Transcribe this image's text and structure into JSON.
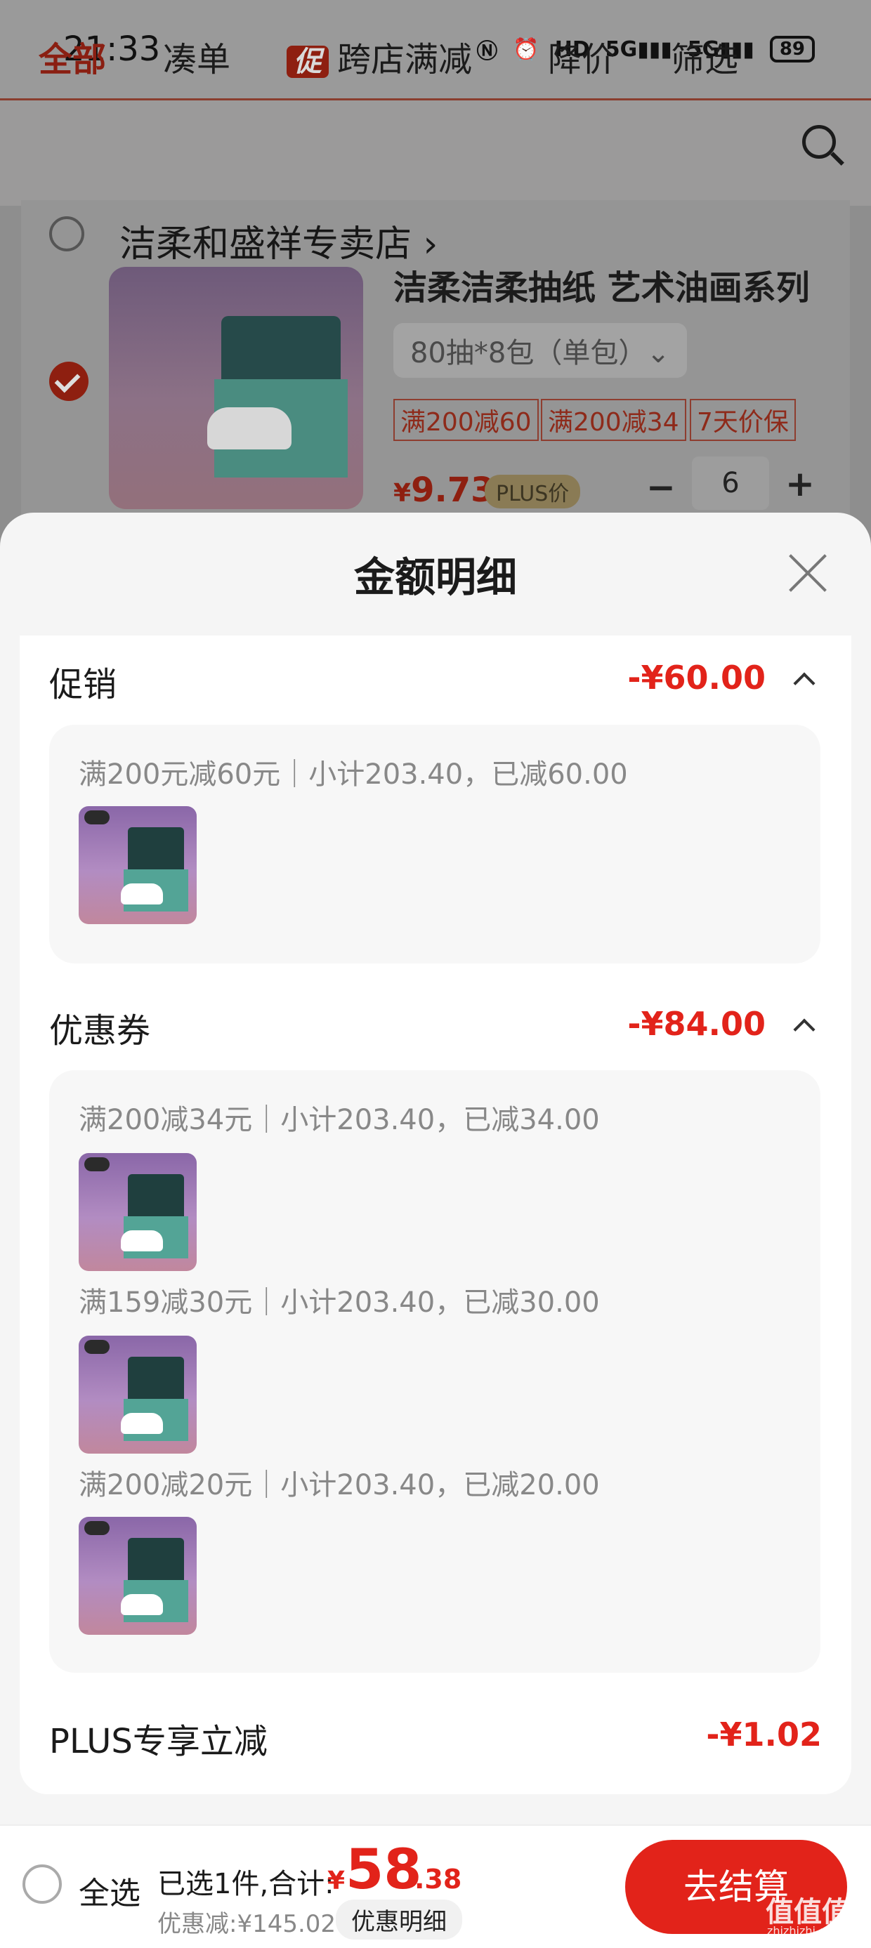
{
  "status_bar": {
    "time": "21:33",
    "icons": [
      "nfc-icon",
      "alarm-icon",
      "hd-icon",
      "signal-5g-icon",
      "signal-5g-icon"
    ],
    "hd_label": "HD",
    "signal1_label": "5G",
    "signal2_label": "5G",
    "battery": "89"
  },
  "tabs": {
    "all": "全部",
    "combine": "凑单",
    "promo_badge": "促",
    "cross_store": "跨店满减",
    "price_drop": "降价",
    "filter": "筛选"
  },
  "store": {
    "name": "洁柔和盛祥专卖店 ›",
    "product": {
      "title": "洁柔洁柔抽纸 艺术油画系列",
      "spec": "80抽*8包（单包）⌄",
      "tags": [
        "满200减60",
        "满200减34",
        "7天价保"
      ],
      "price_symbol": "¥",
      "price": "9.73",
      "plus_label": "PLUS价",
      "quantity": "6",
      "minus": "−",
      "plus": "+"
    }
  },
  "sheet": {
    "title": "金额明细",
    "promotion": {
      "label": "促销",
      "amount": "-¥60.00",
      "lines": [
        "满200元减60元｜小计203.40，已减60.00"
      ]
    },
    "coupons": {
      "label": "优惠券",
      "amount": "-¥84.00",
      "lines": [
        "满200减34元｜小计203.40，已减34.00",
        "满159减30元｜小计203.40，已减30.00",
        "满200减20元｜小计203.40，已减20.00"
      ]
    },
    "plus_discount": {
      "label": "PLUS专享立减",
      "amount": "-¥1.02"
    }
  },
  "bottom_bar": {
    "select_all": "全选",
    "summary": "已选1件,合计:",
    "total_symbol": "¥",
    "total_int": "58",
    "total_dec": ".38",
    "discount": "优惠减:¥145.02",
    "detail_button": "优惠明细",
    "checkout": "去结算"
  },
  "watermark": {
    "text": "值值值",
    "sub": "zhizhizhi.com"
  },
  "colors": {
    "accent": "#e2231a",
    "overlay_dim": "#8e8e8e"
  }
}
